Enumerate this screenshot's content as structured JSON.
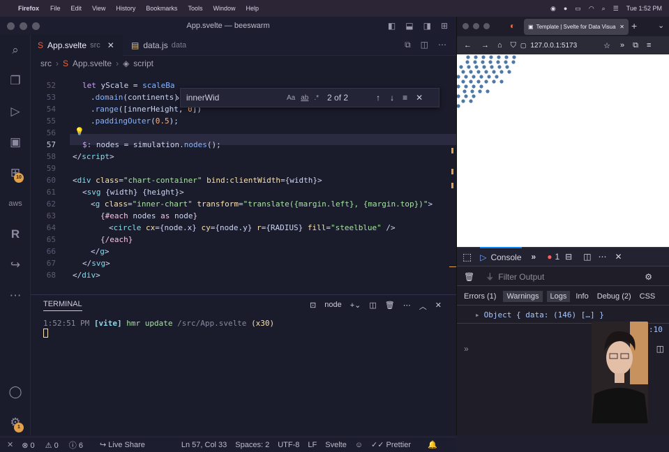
{
  "menubar": {
    "app": "Firefox",
    "items": [
      "File",
      "Edit",
      "View",
      "History",
      "Bookmarks",
      "Tools",
      "Window",
      "Help"
    ],
    "clock": "Tue 1:52 PM"
  },
  "vscode": {
    "title": "App.svelte — beeswarm",
    "tabs": [
      {
        "label": "App.svelte",
        "dir": "src"
      },
      {
        "label": "data.js",
        "dir": "data"
      }
    ],
    "breadcrumb": [
      "src",
      "App.svelte",
      "script"
    ],
    "activity_badges": {
      "extensions": "10",
      "settings": "1"
    },
    "find": {
      "query": "innerWid",
      "result": "2 of 2",
      "opt_case": "Aa",
      "opt_word": "ab",
      "opt_regex": ".*"
    },
    "line_numbers": [
      "52",
      "53",
      "54",
      "55",
      "56",
      "57",
      "58",
      "59",
      "60",
      "61",
      "62",
      "63",
      "64",
      "65",
      "66",
      "67",
      "68"
    ],
    "terminal": {
      "tab_label": "TERMINAL",
      "shell": "node",
      "log_time": "1:52:51 PM",
      "log_tag": "[vite]",
      "log_msg": "hmr update",
      "log_path": "/src/App.svelte",
      "log_count": "(x30)"
    },
    "status": {
      "errors": "0",
      "warnings": "0",
      "info": "6",
      "liveshare": "Live Share",
      "position": "Ln 57, Col 33",
      "spaces": "Spaces: 2",
      "encoding": "UTF-8",
      "eol": "LF",
      "lang": "Svelte",
      "prettier": "Prettier"
    }
  },
  "firefox": {
    "tab_title": "Template | Svelte for Data Visua",
    "url": "127.0.0.1:5173",
    "devtools": {
      "console_tab": "Console",
      "error_count": "1",
      "filter_placeholder": "Filter Output",
      "levels": [
        "Errors (1)",
        "Warnings",
        "Logs",
        "Info",
        "Debug (2)",
        "CSS"
      ],
      "log_entry": "Object { data: (146) […] }",
      "side_value": ":10"
    },
    "dot_color": "#4e79a7"
  }
}
